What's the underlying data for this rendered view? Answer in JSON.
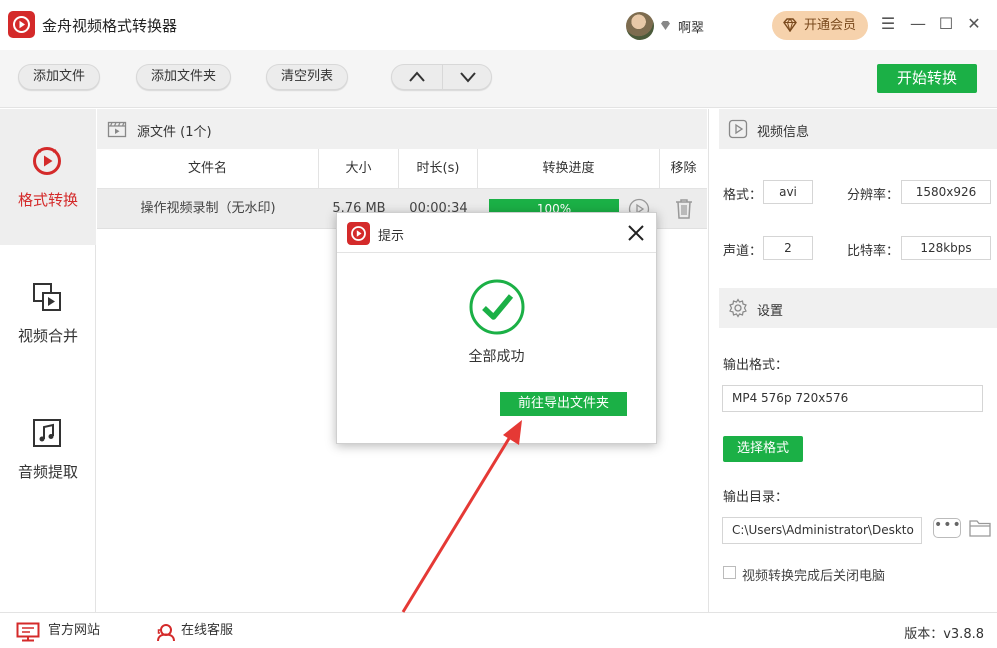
{
  "app": {
    "title": "金舟视频格式转换器",
    "user_name": "啊翠",
    "vip_button": "开通会员",
    "window_controls": {
      "menu": "☰",
      "minimize": "—",
      "maximize": "☐",
      "close": "✕"
    }
  },
  "toolbar": {
    "add_file": "添加文件",
    "add_folder": "添加文件夹",
    "clear_list": "清空列表",
    "start_convert": "开始转换"
  },
  "nav": {
    "items": [
      {
        "label": "格式转换",
        "icon": "format-convert-icon",
        "active": true
      },
      {
        "label": "视频合并",
        "icon": "video-merge-icon",
        "active": false
      },
      {
        "label": "音频提取",
        "icon": "audio-extract-icon",
        "active": false
      }
    ]
  },
  "files": {
    "source_label": "源文件 (1个)",
    "columns": [
      "文件名",
      "大小",
      "时长(s)",
      "转换进度",
      "移除"
    ],
    "rows": [
      {
        "name": "操作视频录制（无水印)",
        "size": "5.76 MB",
        "duration": "00:00:34",
        "progress": "100%",
        "progress_value": 1.0
      }
    ]
  },
  "video_info": {
    "title": "视频信息",
    "format_label": "格式：",
    "format_value": "avi",
    "resolution_label": "分辨率：",
    "resolution_value": "1580x926",
    "channel_label": "声道：",
    "channel_value": "2",
    "bitrate_label": "比特率：",
    "bitrate_value": "128kbps"
  },
  "settings": {
    "title": "设置",
    "output_format_label": "输出格式：",
    "output_format_value": "MP4 576p 720x576",
    "choose_format_button": "选择格式",
    "output_dir_label": "输出目录：",
    "output_dir_value": "C:\\Users\\Administrator\\Deskto",
    "more_button": "•••",
    "shutdown_label": "视频转换完成后关闭电脑"
  },
  "footer": {
    "website": "官方网站",
    "support": "在线客服",
    "version": "版本：v3.8.8"
  },
  "dialog": {
    "title": "提示",
    "message": "全部成功",
    "open_folder_button": "前往导出文件夹"
  },
  "colors": {
    "brand_red": "#d42a2a",
    "accent_green": "#1bb046",
    "vip_gold": "#f6d2ac",
    "annotation_arrow": "#e53935"
  }
}
